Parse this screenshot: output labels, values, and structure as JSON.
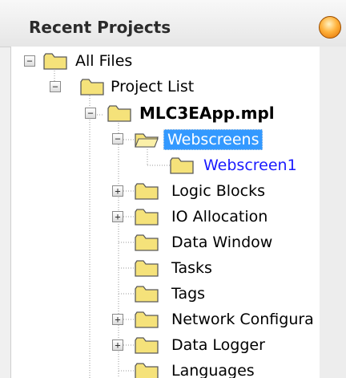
{
  "panel": {
    "title": "Recent Projects",
    "close_icon": "orange-orb-icon"
  },
  "tree": {
    "nodes": [
      {
        "label": "All Files",
        "expander": "minus"
      },
      {
        "label": "Project List",
        "expander": "minus"
      },
      {
        "label": "MLC3EApp.mpl",
        "expander": "minus",
        "bold": true
      },
      {
        "label": "Webscreens",
        "expander": "minus",
        "selected": true,
        "open_folder": true
      },
      {
        "label": "Webscreen1",
        "expander": "none",
        "link": true
      },
      {
        "label": "Logic Blocks",
        "expander": "plus"
      },
      {
        "label": "IO Allocation",
        "expander": "plus"
      },
      {
        "label": "Data Window",
        "expander": "none"
      },
      {
        "label": "Tasks",
        "expander": "none"
      },
      {
        "label": "Tags",
        "expander": "none"
      },
      {
        "label": "Network Configura",
        "expander": "plus"
      },
      {
        "label": "Data Logger",
        "expander": "plus"
      },
      {
        "label": "Languages",
        "expander": "none"
      }
    ]
  },
  "colors": {
    "selection": "#3399ff",
    "link": "#1a1aff",
    "folder": "#f5e27a"
  }
}
